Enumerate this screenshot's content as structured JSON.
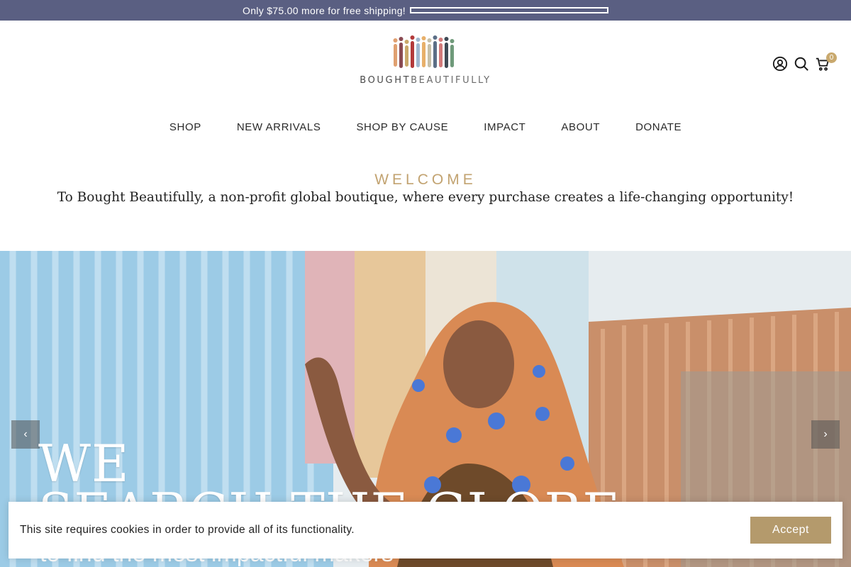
{
  "announcement": {
    "text": "Only $75.00 more for free shipping!",
    "progress_percent": 0
  },
  "logo": {
    "word_bold": "BOUGHT",
    "word_light": "BEAUTIFULLY"
  },
  "header": {
    "cart_count": "0"
  },
  "nav": {
    "items": [
      "SHOP",
      "NEW ARRIVALS",
      "SHOP BY CAUSE",
      "IMPACT",
      "ABOUT",
      "DONATE"
    ]
  },
  "welcome": {
    "title": "WELCOME",
    "subtitle": "To Bought Beautifully, a non-profit global boutique, where every purchase creates a life-changing opportunity!"
  },
  "hero": {
    "prev_label": "‹",
    "next_label": "›",
    "headline_line1": "WE",
    "headline_line2": "SEARCH THE GLOBE",
    "tagline": "to find the most impactful makers"
  },
  "cookie": {
    "text": "This site requires cookies in order to provide all of its functionality.",
    "accept_label": "Accept"
  },
  "colors": {
    "announce_bg": "#5a5f82",
    "accent_gold": "#c2a371",
    "button_gold": "#b49a6c"
  }
}
